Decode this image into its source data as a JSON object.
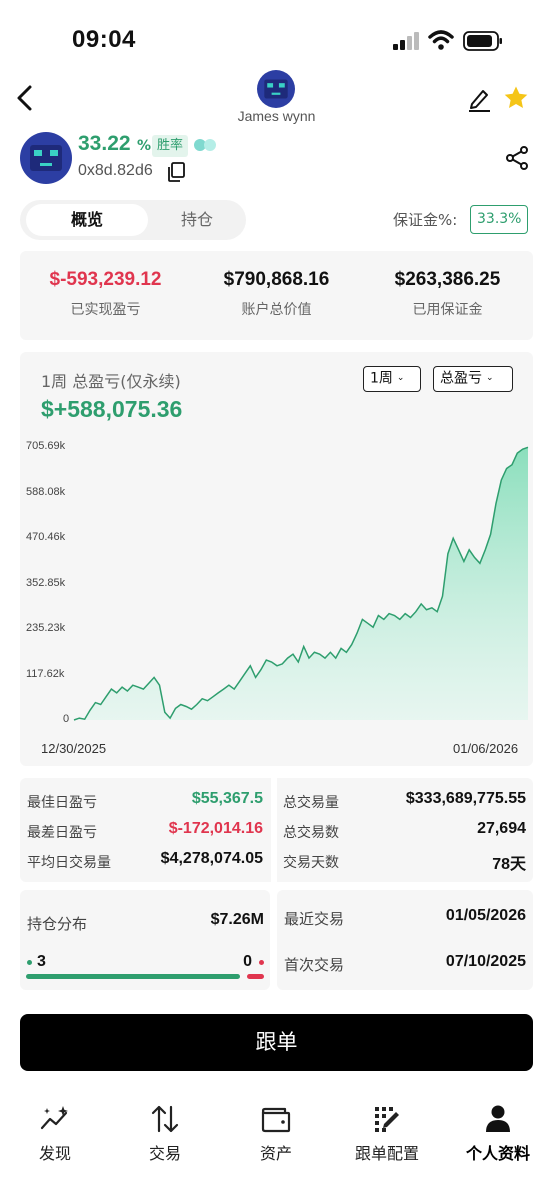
{
  "status_bar": {
    "time": "09:04"
  },
  "header": {
    "name": "James wynn"
  },
  "profile": {
    "win_rate_value": "33.22",
    "win_rate_unit": "%",
    "win_rate_label": "胜率",
    "address": "0x8d.82d6"
  },
  "tabs": [
    {
      "label": "概览"
    },
    {
      "label": "持仓"
    }
  ],
  "margin": {
    "label": "保证金%:",
    "value": "33.3%"
  },
  "summary": [
    {
      "value": "$-593,239.12",
      "label": "已实现盈亏",
      "color": "#e0354e"
    },
    {
      "value": "$790,868.16",
      "label": "账户总价值",
      "color": "#111111"
    },
    {
      "value": "$263,386.25",
      "label": "已用保证金",
      "color": "#111111"
    }
  ],
  "chart": {
    "title": "1周 总盈亏(仅永续)",
    "total": "$+588,075.36",
    "period_select": "1周",
    "metric_select": "总盈亏"
  },
  "chart_data": {
    "type": "area",
    "x_labels": [
      "12/30/2025",
      "01/06/2026"
    ],
    "y_ticks": [
      "705.69k",
      "588.08k",
      "470.46k",
      "352.85k",
      "235.23k",
      "117.62k",
      "0"
    ],
    "ylim": [
      0,
      705.69
    ],
    "unit": "k",
    "color": "#2e9e6e",
    "values": [
      0,
      5,
      2,
      25,
      45,
      40,
      60,
      80,
      70,
      85,
      75,
      90,
      85,
      80,
      95,
      110,
      90,
      20,
      5,
      30,
      40,
      35,
      28,
      40,
      55,
      50,
      60,
      70,
      80,
      90,
      80,
      100,
      120,
      140,
      110,
      130,
      155,
      150,
      140,
      145,
      160,
      170,
      150,
      190,
      160,
      175,
      170,
      160,
      175,
      160,
      185,
      175,
      195,
      225,
      260,
      250,
      240,
      270,
      260,
      275,
      270,
      260,
      275,
      265,
      280,
      300,
      285,
      290,
      280,
      320,
      430,
      470,
      440,
      410,
      440,
      420,
      405,
      440,
      480,
      560,
      620,
      650,
      660,
      690,
      700,
      705
    ]
  },
  "stats": {
    "left": [
      {
        "label": "最佳日盈亏",
        "value": "$55,367.5",
        "color": "#2e9e6e"
      },
      {
        "label": "最差日盈亏",
        "value": "$-172,014.16",
        "color": "#e0354e"
      },
      {
        "label": "平均日交易量",
        "value": "$4,278,074.05",
        "color": "#111111"
      }
    ],
    "right": [
      {
        "label": "总交易量",
        "value": "$333,689,775.55"
      },
      {
        "label": "总交易数",
        "value": "27,694"
      },
      {
        "label": "交易天数",
        "value": "78天"
      }
    ]
  },
  "holdings": {
    "label": "持仓分布",
    "value": "$7.26M",
    "long_count": "3",
    "short_count": "0",
    "long_fraction": 0.93
  },
  "recent": {
    "recent_label": "最近交易",
    "recent_date": "01/05/2026",
    "first_label": "首次交易",
    "first_date": "07/10/2025"
  },
  "follow_button": "跟单",
  "nav": [
    {
      "label": "发现",
      "icon": "sparkle-chart-icon"
    },
    {
      "label": "交易",
      "icon": "swap-arrows-icon"
    },
    {
      "label": "资产",
      "icon": "wallet-icon"
    },
    {
      "label": "跟单配置",
      "icon": "grid-pencil-icon"
    },
    {
      "label": "个人资料",
      "icon": "user-icon"
    }
  ]
}
